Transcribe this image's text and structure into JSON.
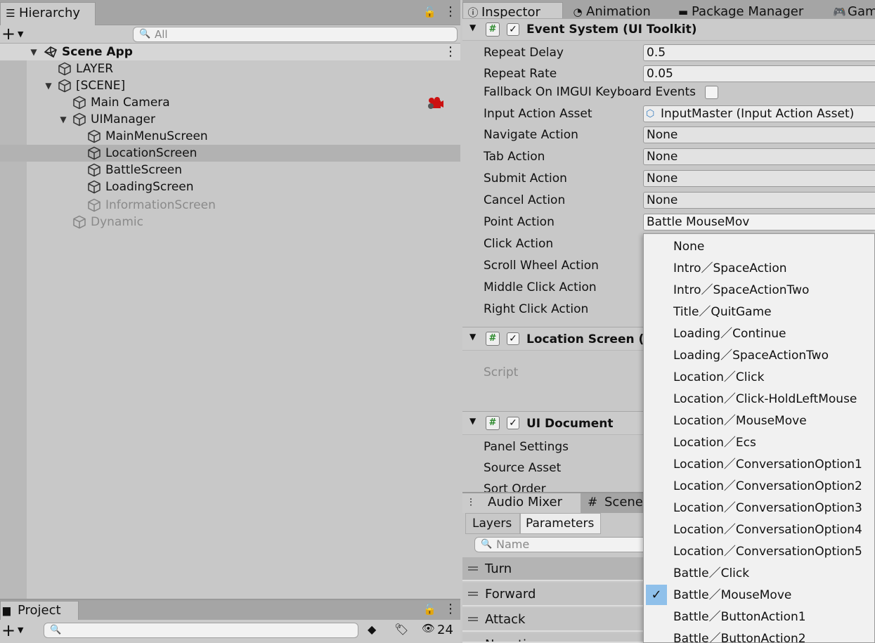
{
  "hierarchy": {
    "tab_label": "Hierarchy",
    "search_placeholder": "All",
    "scene_name": "Scene App",
    "items": [
      {
        "label": "LAYER"
      },
      {
        "label": "[SCENE]"
      },
      {
        "label": "Main Camera"
      },
      {
        "label": "UIManager"
      },
      {
        "label": "MainMenuScreen"
      },
      {
        "label": "LocationScreen"
      },
      {
        "label": "BattleScreen"
      },
      {
        "label": "LoadingScreen"
      },
      {
        "label": "InformationScreen"
      },
      {
        "label": "Dynamic"
      }
    ]
  },
  "project": {
    "tab_label": "Project",
    "hidden_count": "24"
  },
  "tabs": [
    {
      "label": "Inspector"
    },
    {
      "label": "Animation"
    },
    {
      "label": "Package Manager"
    },
    {
      "label": "Gam"
    }
  ],
  "inspector": {
    "event_system": {
      "title": "Event System (UI Toolkit)",
      "fields": [
        {
          "label": "Repeat Delay",
          "value": "0.5"
        },
        {
          "label": "Repeat Rate",
          "value": "0.05"
        },
        {
          "label": "Fallback On IMGUI Keyboard Events",
          "value": ""
        },
        {
          "label": "Input Action Asset",
          "value": "InputMaster (Input Action Asset)"
        },
        {
          "label": "Navigate Action",
          "value": "None"
        },
        {
          "label": "Tab Action",
          "value": "None"
        },
        {
          "label": "Submit Action",
          "value": "None"
        },
        {
          "label": "Cancel Action",
          "value": "None"
        },
        {
          "label": "Point Action",
          "value": "Battle MouseMov"
        },
        {
          "label": "Click Action",
          "value": ""
        },
        {
          "label": "Scroll Wheel Action",
          "value": ""
        },
        {
          "label": "Middle Click Action",
          "value": ""
        },
        {
          "label": "Right Click Action",
          "value": ""
        }
      ]
    },
    "location_screen": {
      "title": "Location Screen (S",
      "script_label": "Script"
    },
    "ui_document": {
      "title": "UI Document",
      "fields": [
        {
          "label": "Panel Settings"
        },
        {
          "label": "Source Asset"
        },
        {
          "label": "Sort Order"
        }
      ]
    }
  },
  "audio_mixer": {
    "tab_label": "Audio Mixer",
    "scene_tab_label": "Scene",
    "subtabs": [
      "Layers",
      "Parameters"
    ],
    "search_placeholder": "Name",
    "params": [
      "Turn",
      "Forward",
      "Attack",
      "Negative"
    ]
  },
  "dropdown": {
    "options": [
      "None",
      "Intro／SpaceAction",
      "Intro／SpaceActionTwo",
      "Title／QuitGame",
      "Loading／Continue",
      "Loading／SpaceActionTwo",
      "Location／Click",
      "Location／Click-HoldLeftMouse",
      "Location／MouseMove",
      "Location／Ecs",
      "Location／ConversationOption1",
      "Location／ConversationOption2",
      "Location／ConversationOption3",
      "Location／ConversationOption4",
      "Location／ConversationOption5",
      "Battle／Click",
      "Battle／MouseMove",
      "Battle／ButtonAction1",
      "Battle／ButtonAction2"
    ],
    "selected": "Battle／MouseMove"
  },
  "colors": {
    "selection": "#8fc0ea",
    "panel": "#c8c8c8",
    "script_hash": "#2c8a2c",
    "camera_gizmo": "#cc1111"
  }
}
